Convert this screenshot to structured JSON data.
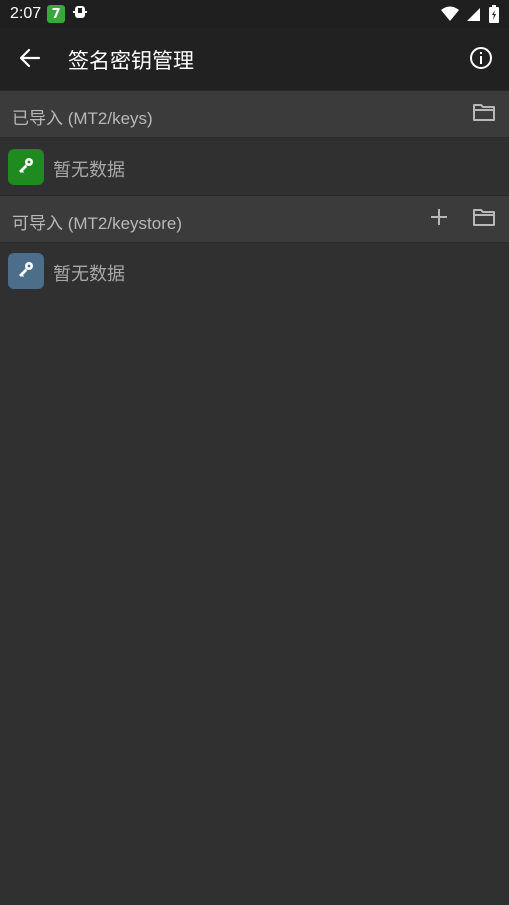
{
  "status_bar": {
    "time": "2:07",
    "badge": "7"
  },
  "app_bar": {
    "title": "签名密钥管理"
  },
  "sections": [
    {
      "label": "已导入 (MT2/keys)",
      "empty_text": "暂无数据",
      "key_color": "#1f8a1f"
    },
    {
      "label": "可导入 (MT2/keystore)",
      "empty_text": "暂无数据",
      "key_color": "#4d6e8a"
    }
  ],
  "icons": {
    "back": "arrow-left-icon",
    "info": "info-circle-icon",
    "folder": "folder-icon",
    "add": "plus-icon",
    "key": "key-icon"
  },
  "colors": {
    "background": "#303030",
    "app_bar": "#212121",
    "section_header": "#3b3b3b"
  }
}
